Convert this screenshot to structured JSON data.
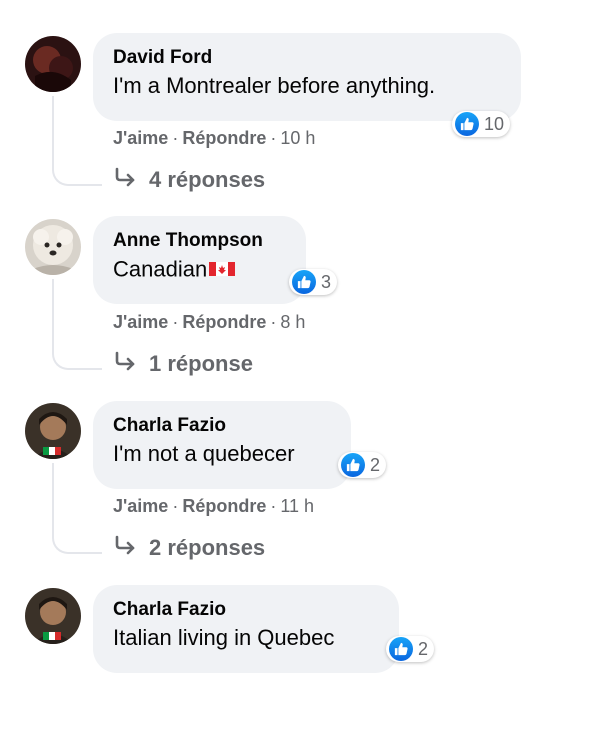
{
  "comments": [
    {
      "author": "David Ford",
      "text": "I'm a Montrealer before anything.",
      "reactions": "10",
      "actions": {
        "like": "J'aime",
        "reply": "Répondre",
        "time": "10 h",
        "dot": "·"
      },
      "replies": "4 réponses"
    },
    {
      "author": "Anne Thompson",
      "text": "Canadian",
      "flag": "canada-flag-icon",
      "reactions": "3",
      "actions": {
        "like": "J'aime",
        "reply": "Répondre",
        "time": "8 h",
        "dot": "·"
      },
      "replies": "1 réponse"
    },
    {
      "author": "Charla Fazio",
      "text": "I'm not a quebecer",
      "reactions": "2",
      "actions": {
        "like": "J'aime",
        "reply": "Répondre",
        "time": "11 h",
        "dot": "·"
      },
      "replies": "2 réponses"
    },
    {
      "author": "Charla Fazio",
      "text": "Italian living in Quebec",
      "reactions": "2"
    }
  ],
  "colors": {
    "bubble": "#f0f2f5",
    "meta_text": "#65676b",
    "like_blue": "#1877f2"
  }
}
